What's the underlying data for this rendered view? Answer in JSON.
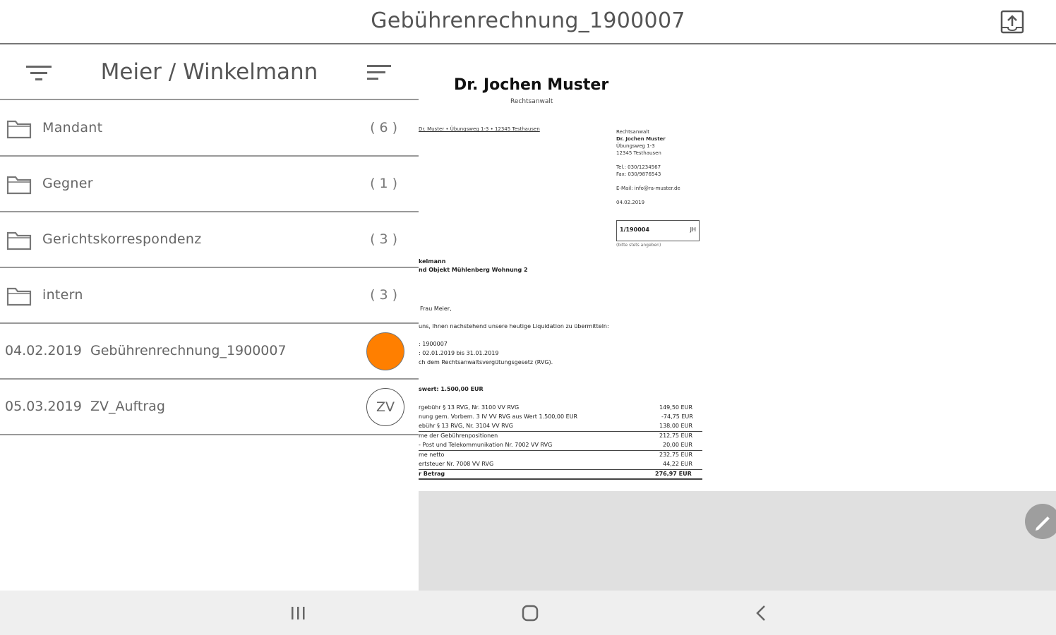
{
  "header": {
    "title": "Gebührenrechnung_1900007",
    "export_icon": "export-icon"
  },
  "left_pane": {
    "title": "Meier / Winkelmann",
    "folders": [
      {
        "label": "Mandant",
        "count": "(6)"
      },
      {
        "label": "Gegner",
        "count": "(1)"
      },
      {
        "label": "Gerichtskorrespondenz",
        "count": "(3)"
      },
      {
        "label": "intern",
        "count": "(3)"
      }
    ],
    "documents": [
      {
        "date": "04.02.2019",
        "name": "Gebührenrechnung_1900007",
        "badge": "",
        "badge_color": "#ff7f00"
      },
      {
        "date": "05.03.2019",
        "name": "ZV_Auftrag",
        "badge": "ZV"
      }
    ]
  },
  "preview": {
    "lawyer": "Dr. Jochen Muster",
    "role": "Rechtsanwalt",
    "sender_line": "Dr. Muster • Übungsweg 1-3 • 12345 Testhausen",
    "address": [
      "Rechtsanwalt",
      "Dr. Jochen Muster",
      "Übungsweg 1-3",
      "12345 Testhausen",
      "",
      "Tel.: 030/1234567",
      "Fax: 030/9876543",
      "",
      "E-Mail: info@ra-muster.de",
      "",
      "04.02.2019"
    ],
    "box_ref": "1/190004",
    "box_suffix": "JH",
    "box_note": "(bitte stets angeben)",
    "subject1": "kelmann",
    "subject2": "nd Objekt Mühlenberg Wohnung 2",
    "salutation": "Frau Meier,",
    "intro": "uns, Ihnen nachstehend unsere heutige Liquidation zu übermitteln:",
    "meta1": ": 1900007",
    "meta2": ": 02.01.2019 bis 31.01.2019",
    "meta3": "ch dem Rechtsanwaltsvergütungsgesetz (RVG).",
    "value_line": "swert: 1.500,00 EUR",
    "items": [
      {
        "text": "rgebühr § 13 RVG, Nr. 3100 VV RVG",
        "amount": "149,50 EUR"
      },
      {
        "text": "nung gem. Vorbem. 3 IV VV RVG aus Wert 1.500,00 EUR",
        "amount": "-74,75 EUR"
      },
      {
        "text": "ebühr § 13 RVG, Nr. 3104 VV RVG",
        "amount": "138,00 EUR"
      },
      {
        "text": "me der Gebührenpositionen",
        "amount": "212,75 EUR"
      },
      {
        "text": "- Post und Telekommunikation Nr. 7002 VV RVG",
        "amount": "20,00 EUR"
      },
      {
        "text": "me netto",
        "amount": "232,75 EUR"
      },
      {
        "text": "ertsteuer Nr. 7008 VV RVG",
        "amount": "44,22 EUR"
      },
      {
        "text": "r Betrag",
        "amount": "276,97 EUR"
      }
    ]
  },
  "navbar": {
    "recent": "recent-apps-icon",
    "home": "home-icon",
    "back": "back-icon"
  }
}
